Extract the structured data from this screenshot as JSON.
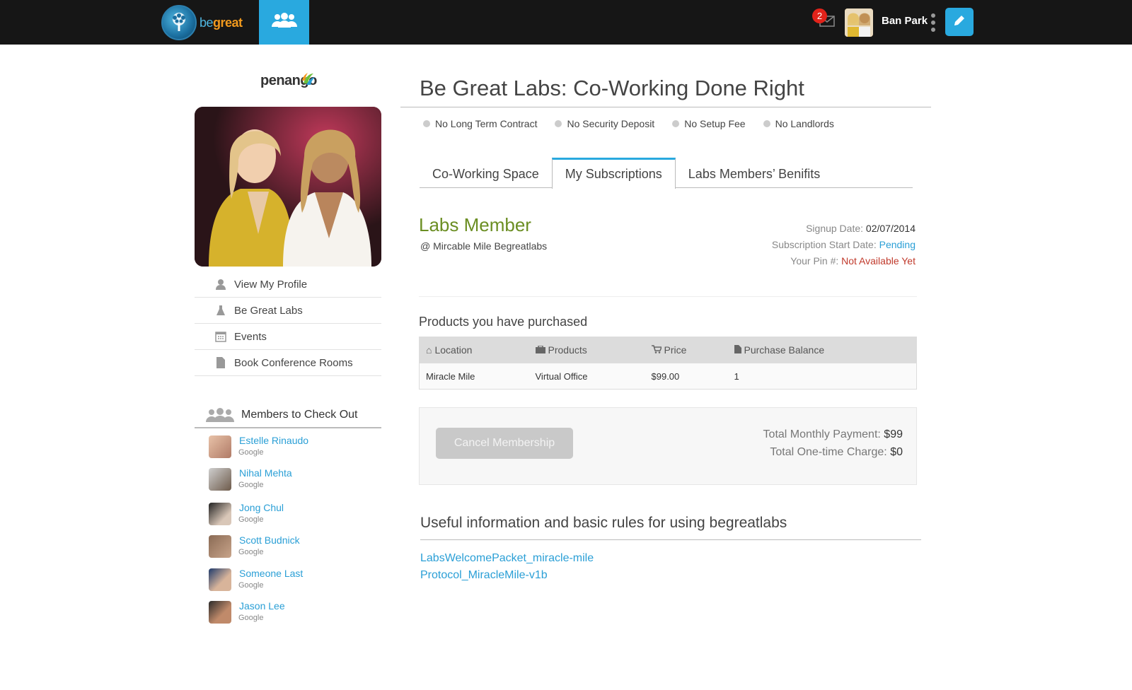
{
  "header": {
    "logo_be": "be",
    "logo_great": "great",
    "mail_count": "2",
    "user_name": "Ban Park"
  },
  "sidebar": {
    "brand": "penango",
    "menu": [
      {
        "label": "View My Profile",
        "icon": "user-icon"
      },
      {
        "label": "Be Great Labs",
        "icon": "flask-icon"
      },
      {
        "label": "Events",
        "icon": "calendar-icon"
      },
      {
        "label": "Book Conference Rooms",
        "icon": "document-icon"
      }
    ],
    "members_title": "Members to Check Out",
    "members": [
      {
        "name": "Estelle Rinaudo",
        "source": "Google"
      },
      {
        "name": "Nihal Mehta",
        "source": "Google"
      },
      {
        "name": "Jong Chul",
        "source": "Google"
      },
      {
        "name": "Scott Budnick",
        "source": "Google"
      },
      {
        "name": "Someone Last",
        "source": "Google"
      },
      {
        "name": "Jason Lee",
        "source": "Google"
      }
    ]
  },
  "main": {
    "title": "Be Great Labs: Co-Working Done Right",
    "features": [
      "No Long Term Contract",
      "No Security Deposit",
      "No Setup Fee",
      "No Landlords"
    ],
    "tabs": [
      {
        "label": "Co-Working Space",
        "active": false
      },
      {
        "label": "My Subscriptions",
        "active": true
      },
      {
        "label": "Labs Members’ Benifits",
        "active": false
      }
    ],
    "membership": {
      "type": "Labs Member",
      "location": "@ Mircable Mile Begreatlabs",
      "signup_label": "Signup Date:",
      "signup_value": "02/07/2014",
      "start_label": "Subscription Start Date:",
      "start_value": "Pending",
      "pin_label": "Your Pin #:",
      "pin_value": "Not Available Yet"
    },
    "products": {
      "heading": "Products you have purchased",
      "columns": [
        "Location",
        "Products",
        "Price",
        "Purchase Balance"
      ],
      "rows": [
        {
          "location": "Miracle Mile",
          "product": "Virtual Office",
          "price": "$99.00",
          "balance": "1"
        }
      ]
    },
    "payment": {
      "cancel_label": "Cancel Membership",
      "monthly_label": "Total Monthly Payment:",
      "monthly_value": "$99",
      "onetime_label": "Total One-time Charge:",
      "onetime_value": "$0"
    },
    "useful": {
      "heading": "Useful information and basic rules for using begreatlabs",
      "links": [
        "LabsWelcomePacket_miracle-mile",
        "Protocol_MiracleMile-v1b"
      ]
    }
  },
  "colors": {
    "accent": "#29a9df",
    "topbar": "#161616",
    "member_type": "#6b8e23",
    "link": "#2a9fd6",
    "alert": "#c0392b"
  }
}
